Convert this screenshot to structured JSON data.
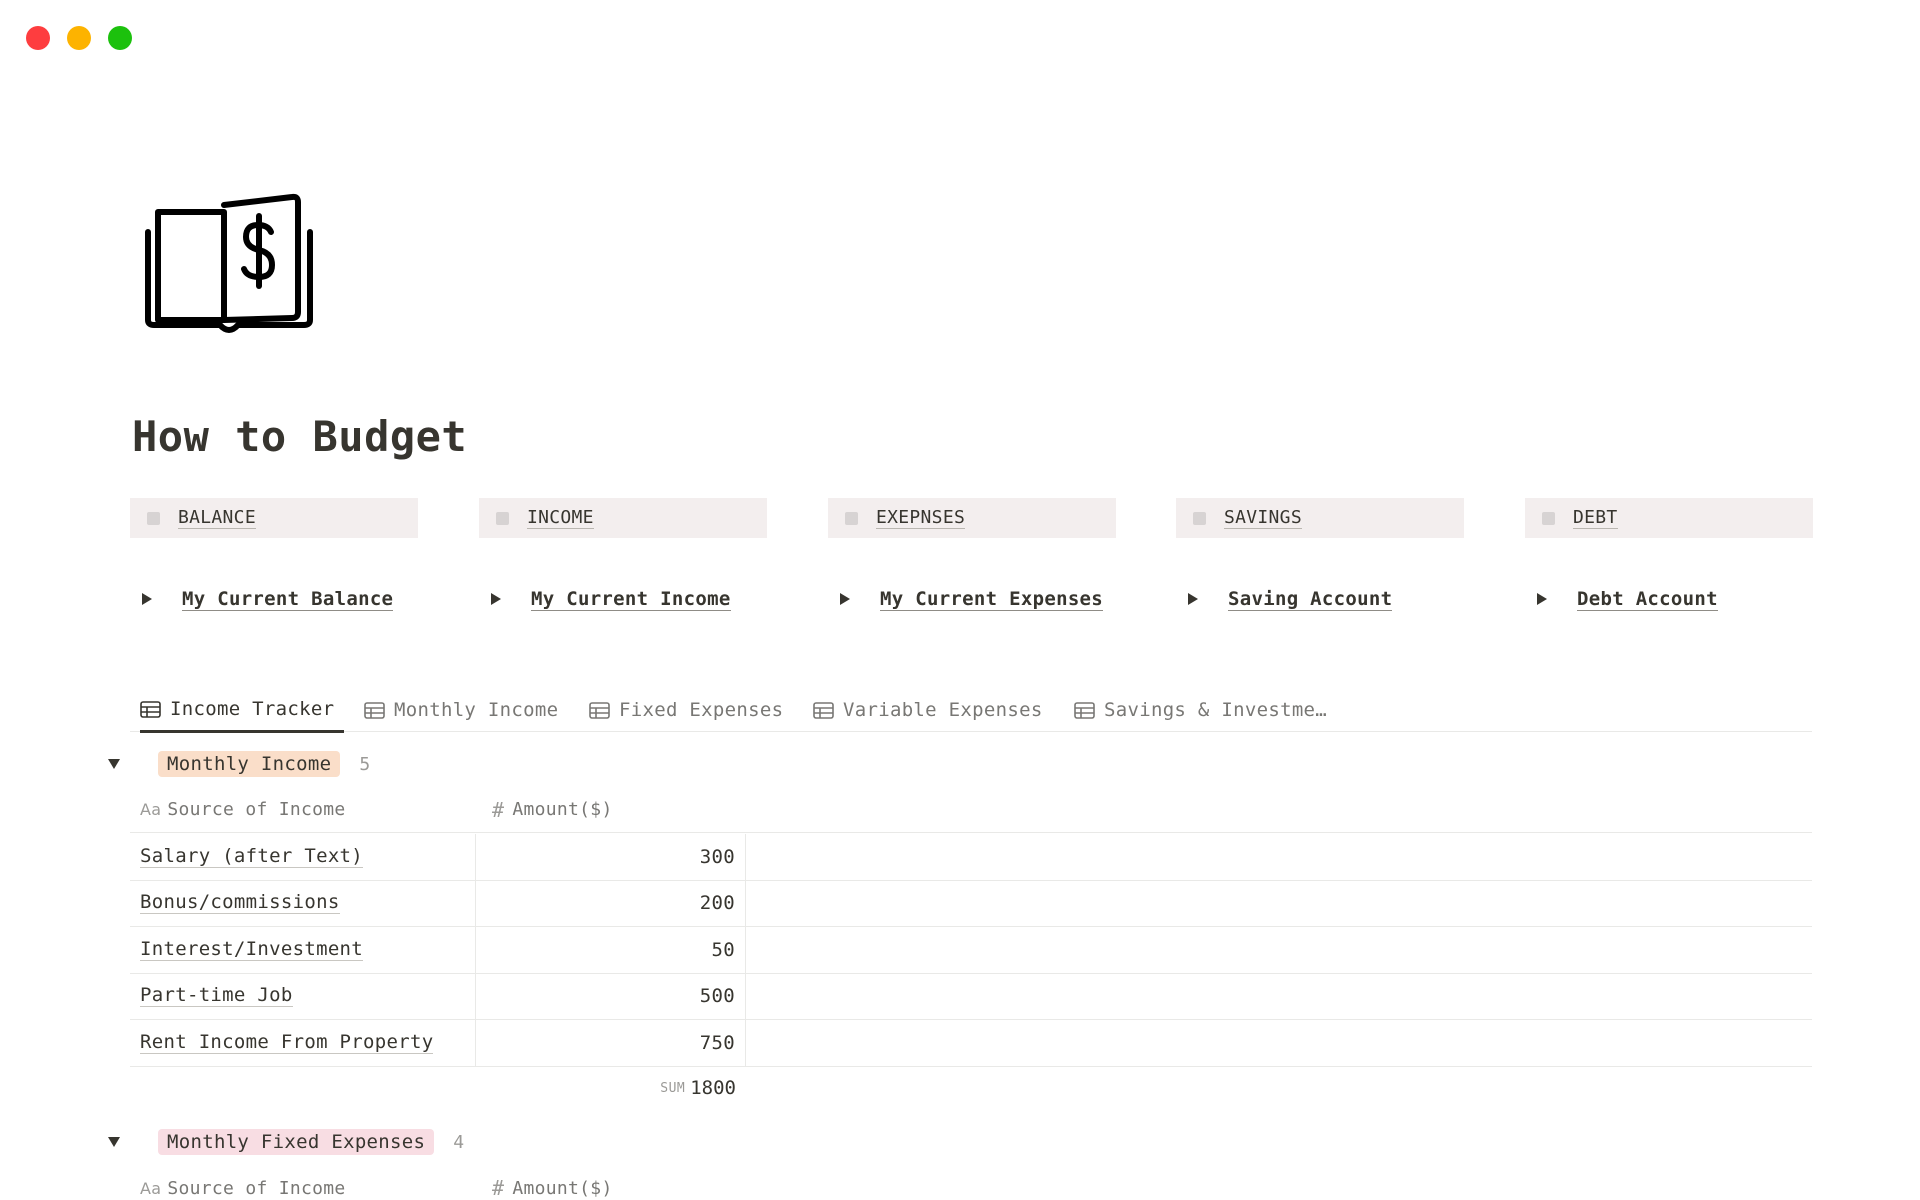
{
  "window": {
    "controls": [
      "close",
      "minimize",
      "maximize"
    ]
  },
  "page": {
    "title": "How to Budget",
    "icon": "money-book-icon"
  },
  "callouts": [
    {
      "label": "BALANCE"
    },
    {
      "label": "INCOME"
    },
    {
      "label": "EXEPNSES"
    },
    {
      "label": "SAVINGS"
    },
    {
      "label": "DEBT"
    }
  ],
  "toggles": [
    {
      "label": "My Current Balance"
    },
    {
      "label": "My Current Income"
    },
    {
      "label": "My Current Expenses"
    },
    {
      "label": "Saving Account"
    },
    {
      "label": "Debt Account"
    }
  ],
  "tabs": [
    {
      "label": "Income Tracker",
      "active": true
    },
    {
      "label": "Monthly Income"
    },
    {
      "label": "Fixed Expenses"
    },
    {
      "label": "Variable Expenses"
    },
    {
      "label": "Savings & Investme…"
    }
  ],
  "groups": [
    {
      "name": "Monthly Income",
      "count": "5",
      "color": "#fadec9",
      "columns": {
        "source": "Source of Income",
        "amount": "Amount($)",
        "source_icon": "Aa",
        "amount_icon": "#"
      },
      "rows": [
        {
          "source": "Salary (after Text)",
          "amount": "300"
        },
        {
          "source": "Bonus/commissions",
          "amount": "200"
        },
        {
          "source": "Interest/Investment",
          "amount": "50"
        },
        {
          "source": "Part-time Job",
          "amount": "500"
        },
        {
          "source": "Rent Income From Property",
          "amount": "750"
        }
      ],
      "sum_label": "SUM",
      "sum_value": "1800"
    },
    {
      "name": "Monthly Fixed Expenses",
      "count": "4",
      "color": "#f8dde3",
      "columns": {
        "source": "Source of Income",
        "amount": "Amount($)",
        "source_icon": "Aa",
        "amount_icon": "#"
      }
    }
  ]
}
